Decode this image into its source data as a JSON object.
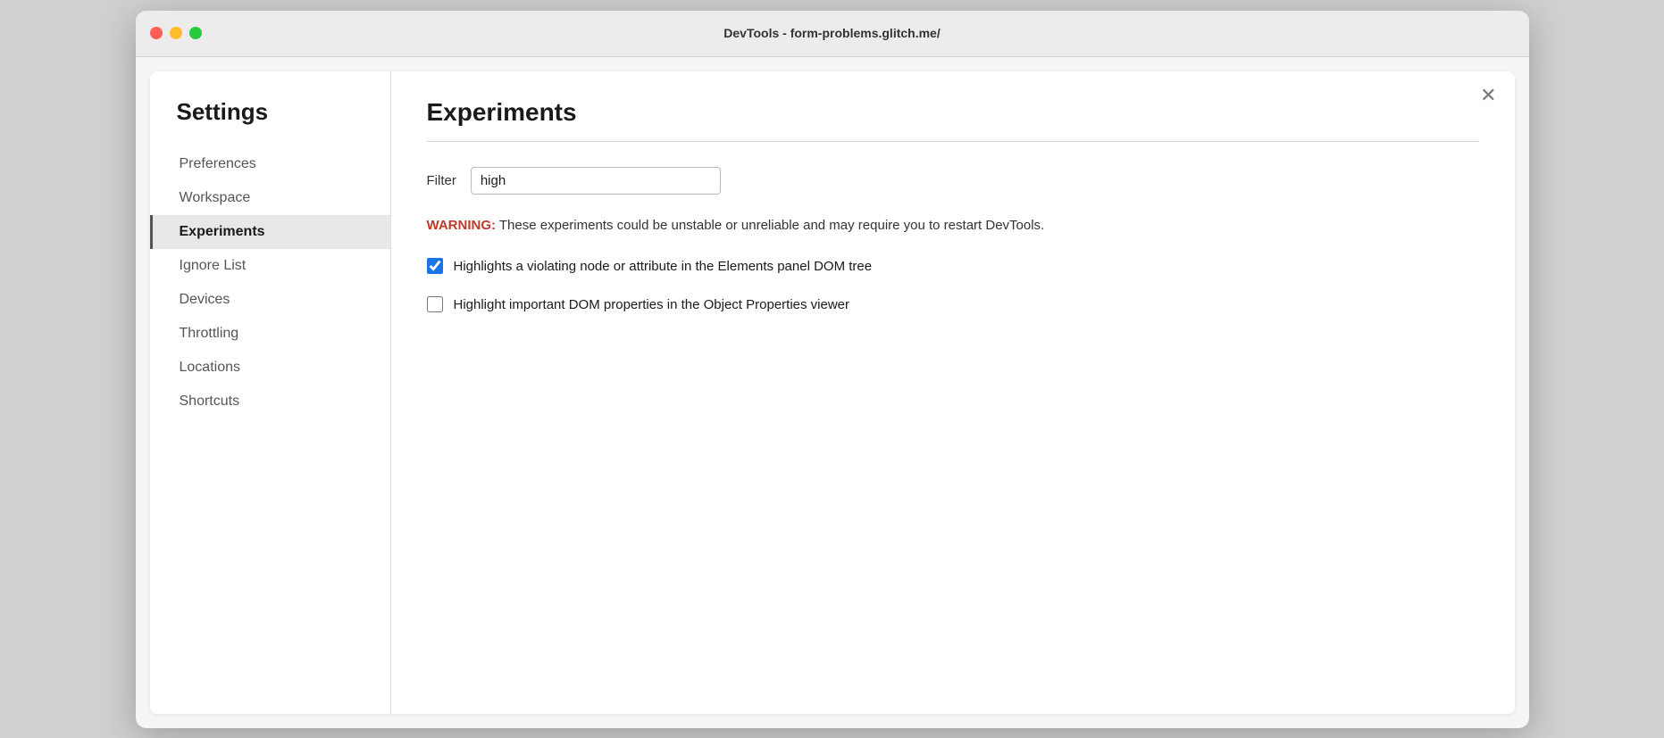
{
  "window": {
    "title": "DevTools - form-problems.glitch.me/"
  },
  "titlebar": {
    "close_icon": "×"
  },
  "sidebar": {
    "heading": "Settings",
    "items": [
      {
        "id": "preferences",
        "label": "Preferences",
        "active": false
      },
      {
        "id": "workspace",
        "label": "Workspace",
        "active": false
      },
      {
        "id": "experiments",
        "label": "Experiments",
        "active": true
      },
      {
        "id": "ignore-list",
        "label": "Ignore List",
        "active": false
      },
      {
        "id": "devices",
        "label": "Devices",
        "active": false
      },
      {
        "id": "throttling",
        "label": "Throttling",
        "active": false
      },
      {
        "id": "locations",
        "label": "Locations",
        "active": false
      },
      {
        "id": "shortcuts",
        "label": "Shortcuts",
        "active": false
      }
    ]
  },
  "main": {
    "page_title": "Experiments",
    "filter": {
      "label": "Filter",
      "value": "high",
      "placeholder": ""
    },
    "warning": {
      "prefix": "WARNING:",
      "text": " These experiments could be unstable or unreliable and may require you to restart DevTools."
    },
    "experiments": [
      {
        "id": "exp1",
        "label": "Highlights a violating node or attribute in the Elements panel DOM tree",
        "checked": true
      },
      {
        "id": "exp2",
        "label": "Highlight important DOM properties in the Object Properties viewer",
        "checked": false
      }
    ]
  },
  "colors": {
    "warning_red": "#c0392b",
    "checkbox_blue": "#1a73e8",
    "active_border": "#555"
  }
}
